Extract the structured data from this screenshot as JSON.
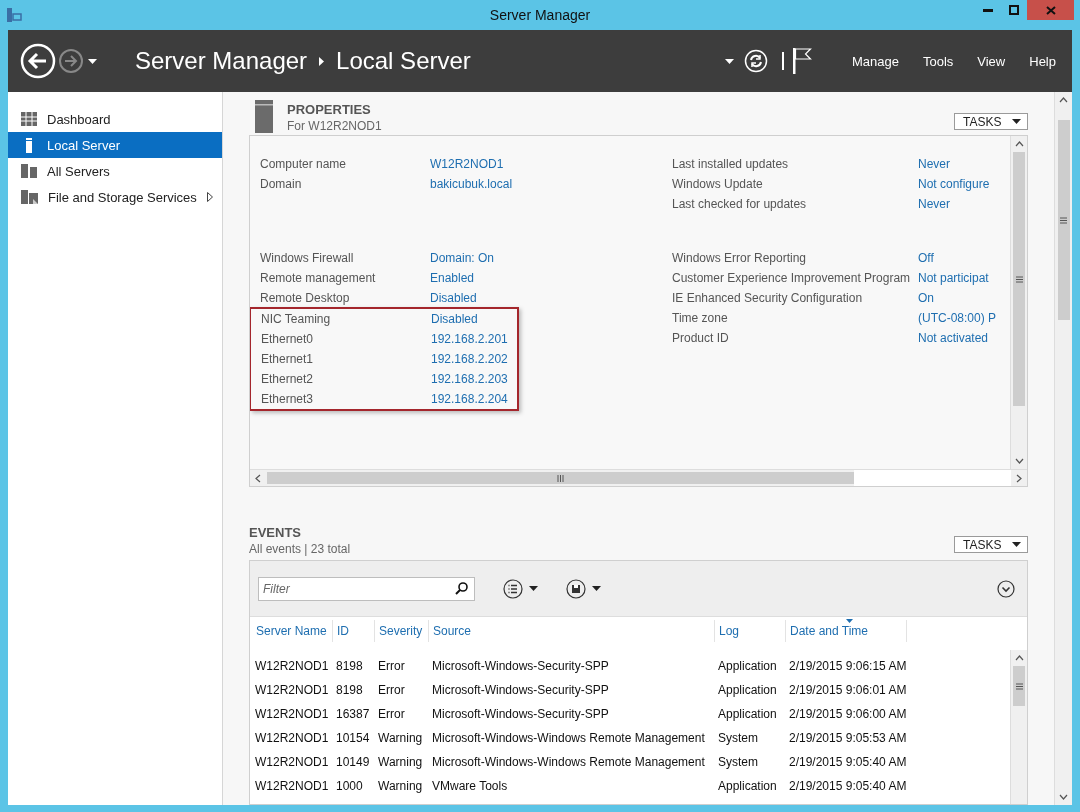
{
  "window": {
    "title": "Server Manager"
  },
  "header": {
    "breadcrumb": [
      "Server Manager",
      "Local Server"
    ],
    "menu": [
      "Manage",
      "Tools",
      "View",
      "Help"
    ]
  },
  "sidebar": {
    "items": [
      {
        "kind": "dashboard",
        "label": "Dashboard",
        "selected": false,
        "submenu": false
      },
      {
        "kind": "server",
        "label": "Local Server",
        "selected": true,
        "submenu": false
      },
      {
        "kind": "servers",
        "label": "All Servers",
        "selected": false,
        "submenu": false
      },
      {
        "kind": "storage",
        "label": "File and Storage Services",
        "selected": false,
        "submenu": true
      }
    ]
  },
  "properties": {
    "title": "PROPERTIES",
    "subtitle": "For W12R2NOD1",
    "tasks": "TASKS",
    "blocks": [
      {
        "left": [
          {
            "label": "Computer name",
            "value": "W12R2NOD1",
            "highlighted": false
          },
          {
            "label": "Domain",
            "value": "bakicubuk.local",
            "highlighted": false
          }
        ],
        "right": [
          {
            "label": "Last installed updates",
            "value": "Never"
          },
          {
            "label": "Windows Update",
            "value": "Not configure"
          },
          {
            "label": "Last checked for updates",
            "value": "Never"
          }
        ]
      },
      {
        "left": [
          {
            "label": "Windows Firewall",
            "value": "Domain: On",
            "highlighted": false
          },
          {
            "label": "Remote management",
            "value": "Enabled",
            "highlighted": false
          },
          {
            "label": "Remote Desktop",
            "value": "Disabled",
            "highlighted": false
          },
          {
            "label": "NIC Teaming",
            "value": "Disabled",
            "highlighted": true
          },
          {
            "label": "Ethernet0",
            "value": "192.168.2.201",
            "highlighted": true
          },
          {
            "label": "Ethernet1",
            "value": "192.168.2.202",
            "highlighted": true
          },
          {
            "label": "Ethernet2",
            "value": "192.168.2.203",
            "highlighted": true
          },
          {
            "label": "Ethernet3",
            "value": "192.168.2.204",
            "highlighted": true
          }
        ],
        "right": [
          {
            "label": "Windows Error Reporting",
            "value": "Off"
          },
          {
            "label": "Customer Experience Improvement Program",
            "value": "Not participat"
          },
          {
            "label": "IE Enhanced Security Configuration",
            "value": "On"
          },
          {
            "label": "Time zone",
            "value": "(UTC-08:00) P"
          },
          {
            "label": "Product ID",
            "value": "Not activated"
          }
        ]
      }
    ]
  },
  "events": {
    "title": "EVENTS",
    "subtitle": "All events | 23 total",
    "tasks": "TASKS",
    "filter": {
      "placeholder": "Filter"
    },
    "columns": [
      {
        "label": "Server Name",
        "sorted": false
      },
      {
        "label": "ID",
        "sorted": false
      },
      {
        "label": "Severity",
        "sorted": false
      },
      {
        "label": "Source",
        "sorted": false
      },
      {
        "label": "Log",
        "sorted": false
      },
      {
        "label": "Date and Time",
        "sorted": true
      }
    ],
    "rows": [
      [
        "W12R2NOD1",
        "8198",
        "Error",
        "Microsoft-Windows-Security-SPP",
        "Application",
        "2/19/2015 9:06:15 AM"
      ],
      [
        "W12R2NOD1",
        "8198",
        "Error",
        "Microsoft-Windows-Security-SPP",
        "Application",
        "2/19/2015 9:06:01 AM"
      ],
      [
        "W12R2NOD1",
        "16387",
        "Error",
        "Microsoft-Windows-Security-SPP",
        "Application",
        "2/19/2015 9:06:00 AM"
      ],
      [
        "W12R2NOD1",
        "10154",
        "Warning",
        "Microsoft-Windows-Windows Remote Management",
        "System",
        "2/19/2015 9:05:53 AM"
      ],
      [
        "W12R2NOD1",
        "10149",
        "Warning",
        "Microsoft-Windows-Windows Remote Management",
        "System",
        "2/19/2015 9:05:40 AM"
      ],
      [
        "W12R2NOD1",
        "1000",
        "Warning",
        "VMware Tools",
        "Application",
        "2/19/2015 9:05:40 AM"
      ]
    ]
  }
}
